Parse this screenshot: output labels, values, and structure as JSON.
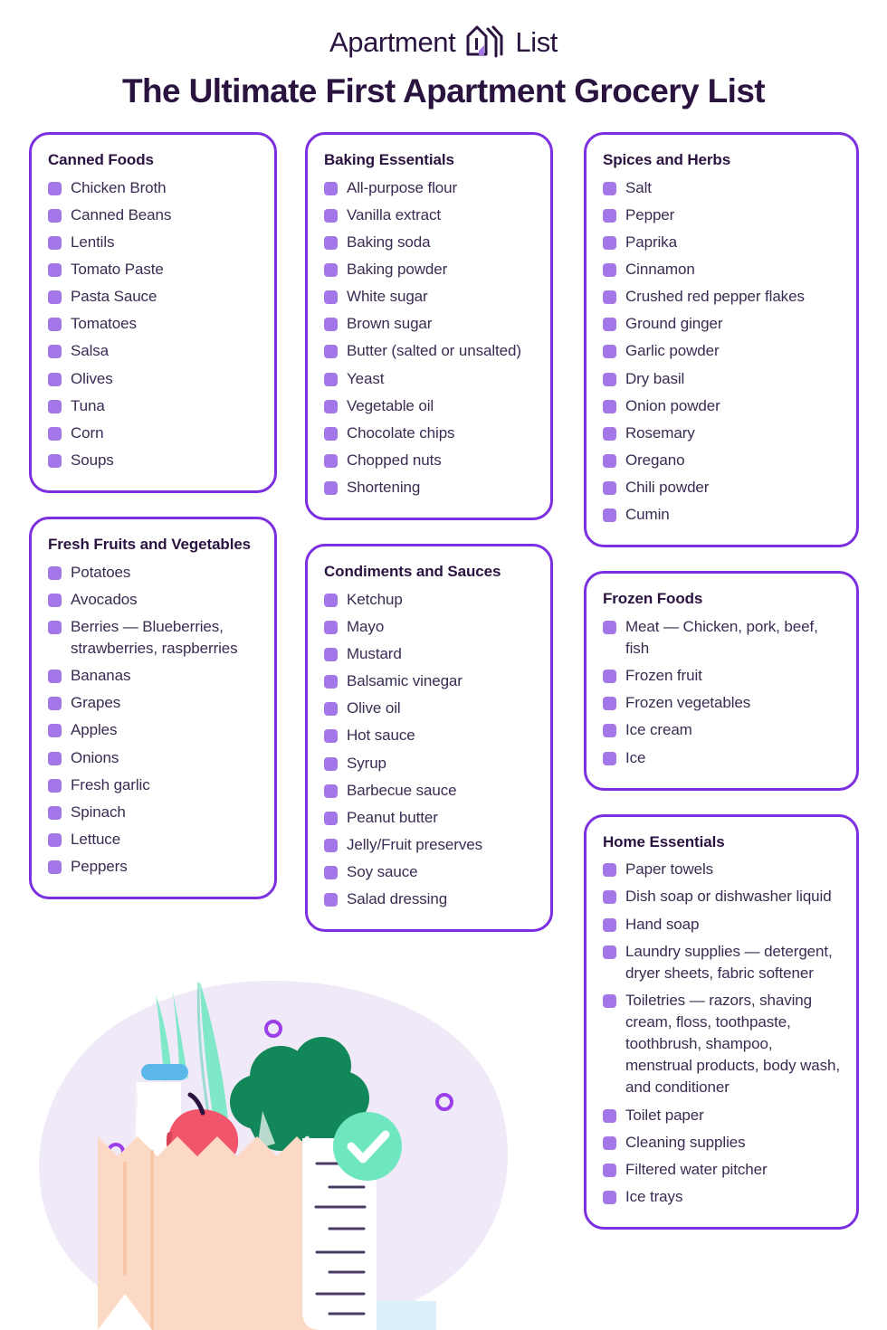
{
  "brand": {
    "name_left": "Apartment",
    "name_right": "List",
    "logo_icon": "apartment-list-house-icon",
    "accent_color": "#7B2FE0",
    "text_color": "#2B1340"
  },
  "header": {
    "title": "The Ultimate First Apartment Grocery List"
  },
  "colors": {
    "card_border": "#7B2FE0",
    "checkbox": "#A377E8",
    "heading": "#2B1340",
    "item_text": "#3B2B52",
    "blob": "#F0E9F8",
    "bag": "#FBD9C4",
    "leek": "#7EE8C8",
    "broccoli": "#12875A",
    "apple": "#F2556B",
    "milk_cap": "#5BB8E8",
    "check_circle": "#6EE7C0",
    "ring": "#9B3FE8"
  },
  "columns": [
    {
      "name": "column-one",
      "cards": [
        {
          "id": "canned-foods",
          "title": "Canned Foods",
          "items": [
            "Chicken Broth",
            "Canned Beans",
            "Lentils",
            "Tomato Paste",
            "Pasta Sauce",
            "Tomatoes",
            "Salsa",
            "Olives",
            "Tuna",
            "Corn",
            "Soups"
          ]
        },
        {
          "id": "fresh-fruits-and-vegetables",
          "title": "Fresh Fruits and Vegetables",
          "items": [
            "Potatoes",
            "Avocados",
            "Berries — Blueberries, strawberries, raspberries",
            "Bananas",
            "Grapes",
            "Apples",
            "Onions",
            "Fresh garlic",
            "Spinach",
            "Lettuce",
            "Peppers"
          ]
        }
      ]
    },
    {
      "name": "column-two",
      "cards": [
        {
          "id": "baking-essentials",
          "title": "Baking Essentials",
          "items": [
            "All-purpose flour",
            "Vanilla extract",
            "Baking soda",
            "Baking powder",
            "White sugar",
            "Brown sugar",
            "Butter (salted or unsalted)",
            "Yeast",
            "Vegetable oil",
            "Chocolate chips",
            "Chopped nuts",
            "Shortening"
          ]
        },
        {
          "id": "condiments-and-sauces",
          "title": "Condiments and Sauces",
          "items": [
            "Ketchup",
            "Mayo",
            "Mustard",
            "Balsamic vinegar",
            "Olive oil",
            "Hot sauce",
            "Syrup",
            "Barbecue sauce",
            "Peanut butter",
            "Jelly/Fruit preserves",
            "Soy sauce",
            "Salad dressing"
          ]
        }
      ]
    },
    {
      "name": "column-three",
      "cards": [
        {
          "id": "spices-and-herbs",
          "title": "Spices and Herbs",
          "items": [
            "Salt",
            "Pepper",
            "Paprika",
            "Cinnamon",
            "Crushed red pepper flakes",
            "Ground ginger",
            "Garlic powder",
            "Dry basil",
            "Onion powder",
            "Rosemary",
            "Oregano",
            "Chili powder",
            "Cumin"
          ]
        },
        {
          "id": "frozen-foods",
          "title": "Frozen Foods",
          "items": [
            "Meat — Chicken, pork, beef, fish",
            "Frozen fruit",
            "Frozen vegetables",
            "Ice cream",
            "Ice"
          ]
        },
        {
          "id": "home-essentials",
          "title": "Home Essentials",
          "items": [
            "Paper towels",
            "Dish soap or dishwasher liquid",
            "Hand soap",
            "Laundry supplies — detergent, dryer sheets, fabric softener",
            "Toiletries — razors, shaving cream, floss, toothpaste, toothbrush, shampoo, menstrual products, body wash, and conditioner",
            "Toilet paper",
            "Cleaning supplies",
            "Filtered water pitcher",
            "Ice trays"
          ]
        }
      ]
    }
  ],
  "illustration": {
    "name": "grocery-bag-illustration",
    "elements": [
      "blob-background",
      "grocery-bag",
      "leek-leaves",
      "milk-carton",
      "apple",
      "broccoli",
      "receipt-list",
      "check-circle-icon",
      "decorative-rings"
    ]
  }
}
